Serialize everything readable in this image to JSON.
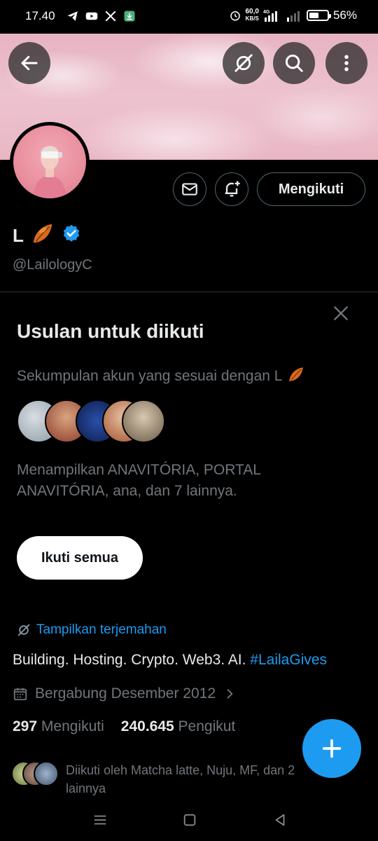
{
  "status_bar": {
    "time": "17.40",
    "speed_value": "60,0",
    "speed_unit": "KB/S",
    "network": "4G",
    "battery": "56%",
    "battery_level": 0.56
  },
  "profile": {
    "name": "L",
    "handle": "@LailologyC",
    "follow_button": "Mengikuti",
    "verified": true
  },
  "suggestions": {
    "title": "Usulan untuk diikuti",
    "subtitle": "Sekumpulan akun yang sesuai dengan L",
    "description": "Menampilkan ANAVITÓRIA, PORTAL ANAVITÓRIA, ana, dan 7 lainnya.",
    "follow_all": "Ikuti semua"
  },
  "translate_link": "Tampilkan terjemahan",
  "bio": {
    "text": "Building. Hosting. Crypto. Web3. AI.",
    "hashtag": "#LailaGives"
  },
  "joined": "Bergabung Desember 2012",
  "stats": {
    "following_count": "297",
    "following_label": "Mengikuti",
    "followers_count": "240.645",
    "followers_label": "Pengikut"
  },
  "followed_by": "Diikuti oleh Matcha latte, Nuju, MF, dan 2 lainnya",
  "colors": {
    "accent": "#1d9bf0",
    "background": "#000000",
    "muted_text": "#71767b",
    "banner_pink": "#e9b6c4"
  },
  "icons": {
    "back": "arrow-left-icon",
    "translate": "translate-icon",
    "search": "search-icon",
    "more": "more-vertical-icon",
    "message": "mail-icon",
    "notify": "bell-plus-icon",
    "close": "close-icon",
    "calendar": "calendar-icon",
    "compose": "plus-icon"
  }
}
